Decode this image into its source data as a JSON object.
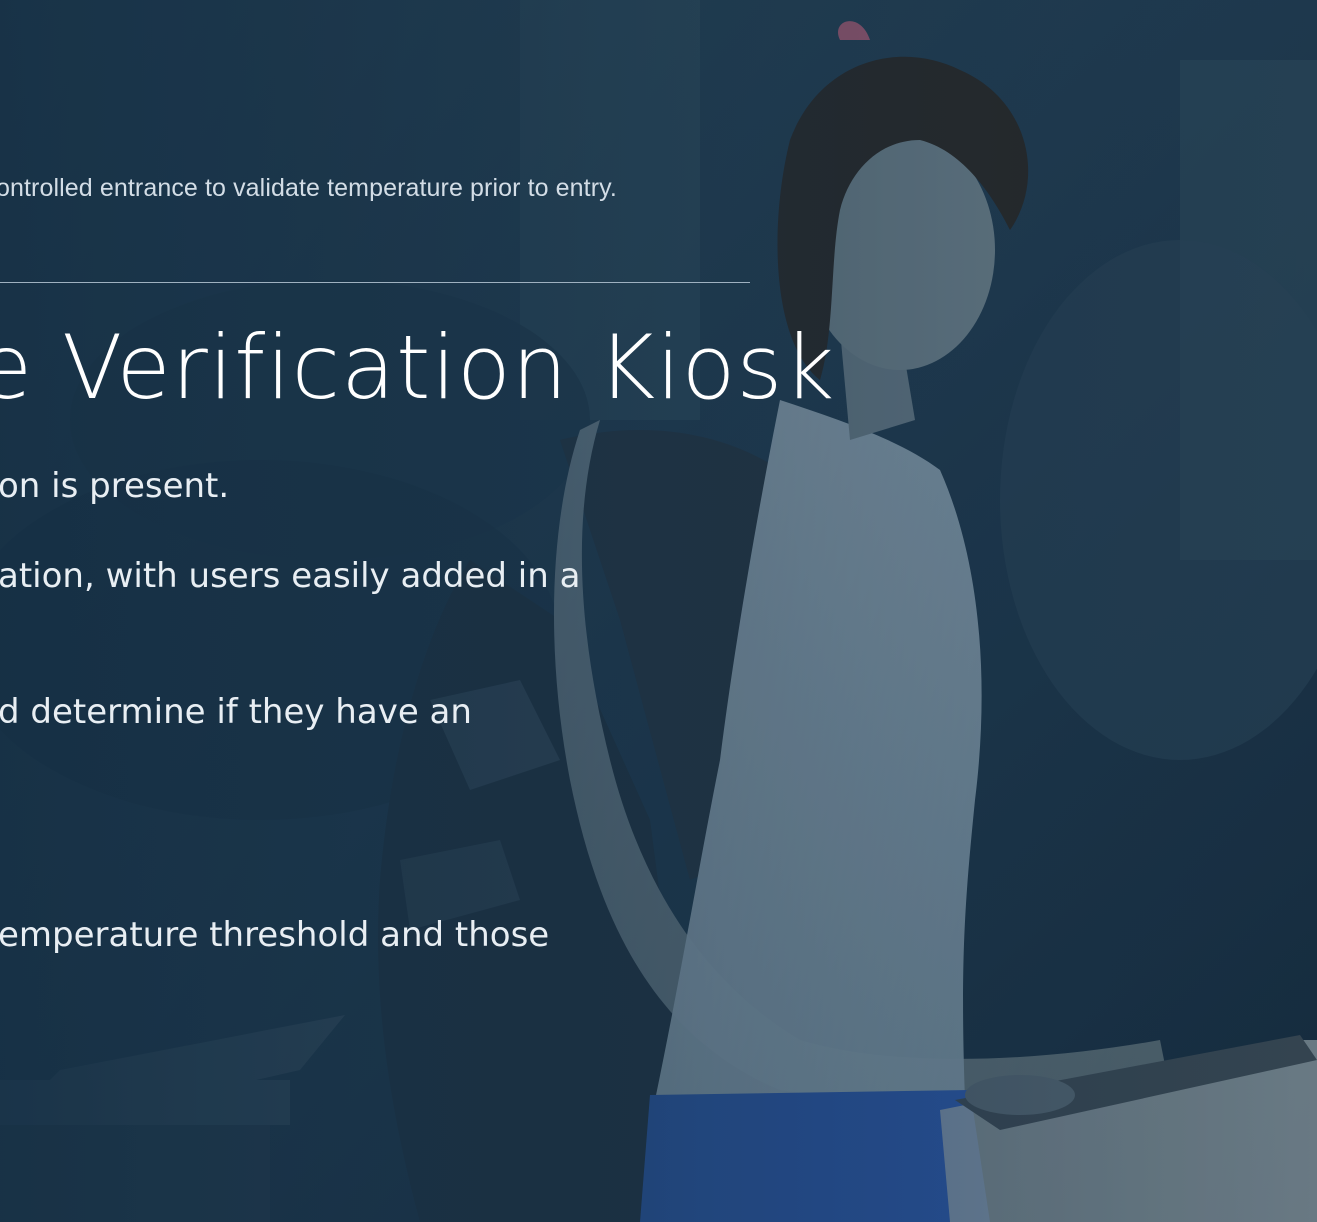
{
  "slide": {
    "subtitle": "ontrolled entrance to validate temperature prior to entry.",
    "title": "e Verification Kiosk",
    "bullets": [
      "on is present.",
      "ation, with users easily added in a",
      "d determine if they have an",
      "emperature threshold and those"
    ]
  },
  "background": {
    "description_icon": "person-at-kiosk-photo",
    "overlay_color": "#1b3246"
  }
}
